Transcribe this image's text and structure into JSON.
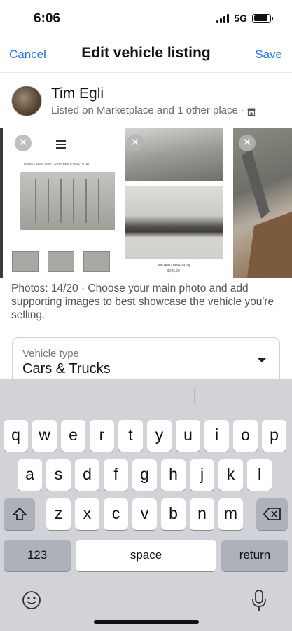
{
  "status": {
    "time": "6:06",
    "network": "5G",
    "battery_level": 0.9
  },
  "nav": {
    "cancel": "Cancel",
    "title": "Edit vehicle listing",
    "save": "Save"
  },
  "user": {
    "name": "Tim Egli",
    "listed_on": "Listed on Marketplace and 1 other place ·"
  },
  "photos": {
    "items": [
      {
        "caption": "",
        "breadcrumb": "Home › Rear Bed › Rear Bed (1960-1974)"
      },
      {
        "caption": "Mid Bed (1958-1978)",
        "price": "$295.00"
      },
      {
        "caption": ""
      }
    ],
    "note": "Photos: 14/20 · Choose your main photo and add supporting images to best showcase the vehicle you're selling."
  },
  "vehicle_type": {
    "label": "Vehicle type",
    "value": "Cars & Trucks"
  },
  "keyboard": {
    "row1": [
      "q",
      "w",
      "e",
      "r",
      "t",
      "y",
      "u",
      "i",
      "o",
      "p"
    ],
    "row2": [
      "a",
      "s",
      "d",
      "f",
      "g",
      "h",
      "j",
      "k",
      "l"
    ],
    "row3": [
      "z",
      "x",
      "c",
      "v",
      "b",
      "n",
      "m"
    ],
    "numbers": "123",
    "space": "space",
    "return": "return"
  },
  "icons": {
    "remove": "close-icon",
    "menu": "hamburger-icon",
    "shift": "shift-icon",
    "backspace": "backspace-icon",
    "emoji": "emoji-icon",
    "mic": "microphone-icon",
    "store": "store-icon"
  },
  "colors": {
    "accent": "#1b74e4",
    "keyboard_bg": "#d1d3d9"
  }
}
